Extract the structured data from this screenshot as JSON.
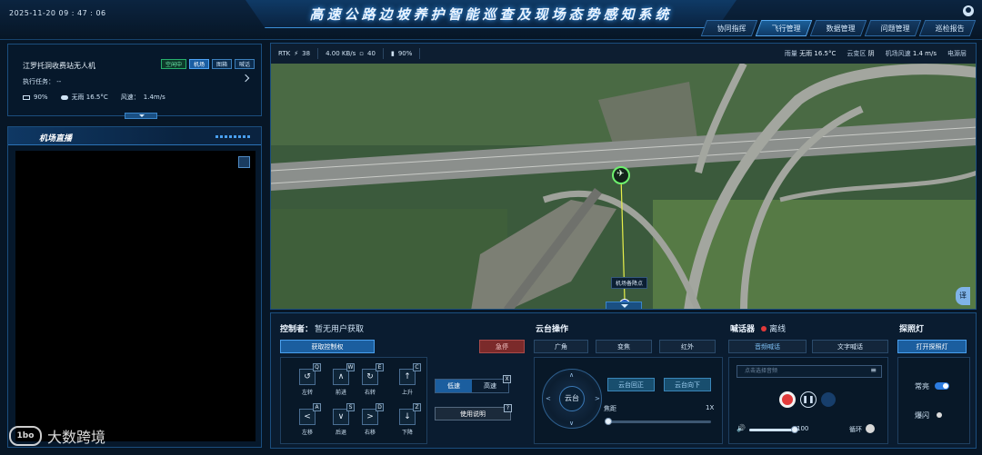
{
  "header": {
    "datetime": "2025-11-20  09 : 47 : 06",
    "title": "高速公路边坡养护智能巡查及现场态势感知系统",
    "nav": [
      "协同指挥",
      "飞行管理",
      "数据管理",
      "问题管理",
      "巡检报告"
    ],
    "nav_active": 1
  },
  "drone": {
    "name": "江罗托洞收费站无人机",
    "badges": [
      "空闲中",
      "机场",
      "图箱",
      "喊话"
    ],
    "task_label": "执行任务：",
    "task_value": "--",
    "battery": "90%",
    "weather": "无雨 16.5°C",
    "wind_label": "风速：",
    "wind_value": "1.4m/s"
  },
  "live": {
    "title": "机场直播"
  },
  "statusbar": {
    "rtk_label": "RTK",
    "rtk_value": "38",
    "speed": "4.00 KB/s",
    "signal": "40",
    "battery": "90%",
    "rain_label": "雨量",
    "rain_value": "无雨",
    "temp": "16.5°C",
    "cloud_label": "云变区",
    "cloud_value": "阴",
    "wind_label": "机场风速",
    "wind_value": "1.4 m/s",
    "power_label": "电源层"
  },
  "map": {
    "dock_label": "机场备降点",
    "side_tab": "译"
  },
  "control": {
    "controller_label": "控制者：",
    "controller_value": "暂无用户获取",
    "acquire_button": "获取控制权",
    "emergency_button": "急停",
    "keys": [
      {
        "letter": "Q",
        "icon": "↺",
        "label": "左转"
      },
      {
        "letter": "W",
        "icon": "∧",
        "label": "前进"
      },
      {
        "letter": "E",
        "icon": "↻",
        "label": "右转"
      },
      {
        "letter": "C",
        "icon": "↑",
        "label": "上升"
      },
      {
        "letter": "A",
        "icon": "<",
        "label": "左移"
      },
      {
        "letter": "S",
        "icon": "∨",
        "label": "后退"
      },
      {
        "letter": "D",
        "icon": ">",
        "label": "右移"
      },
      {
        "letter": "Z",
        "icon": "↓",
        "label": "下降"
      }
    ],
    "speed_low": "低速",
    "speed_high": "高速",
    "speed_active": "低速",
    "close_mark": "X",
    "help_button": "使用说明",
    "help_mark": "?"
  },
  "gimbal": {
    "title": "云台操作",
    "tabs": [
      "广角",
      "变焦",
      "红外"
    ],
    "center": "云台",
    "reset_button": "云台回正",
    "down_button": "云台向下",
    "focus_label": "焦距",
    "focus_value": "1X",
    "focus_level": 0.03
  },
  "speaker": {
    "title": "喊话器",
    "status": "离线",
    "tabs": [
      "音频喊话",
      "文字喊话"
    ],
    "select_placeholder": "点击选择音频",
    "volume": "100",
    "volume_level": 1.0,
    "loop_label": "循环"
  },
  "light": {
    "title": "探照灯",
    "open_button": "打开探照灯",
    "steady_label": "常亮",
    "flash_label": "爆闪"
  },
  "watermark": {
    "logo": "1bo",
    "text": "大数跨境"
  },
  "colors": {
    "accent": "#1b5e9f",
    "danger": "#7b2a2a",
    "online": "#27b06c",
    "offline": "#e23a3a"
  }
}
